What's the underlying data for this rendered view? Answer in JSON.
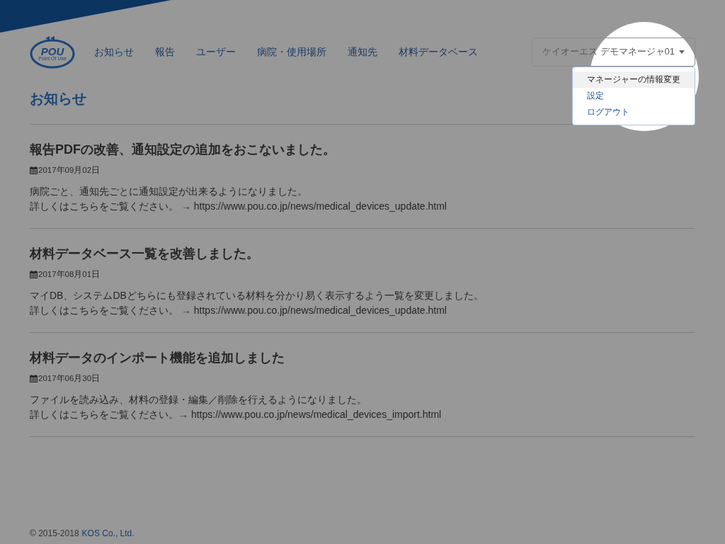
{
  "header": {
    "logo": {
      "text": "POU",
      "subtext": "Point Of Use"
    },
    "nav_items": [
      "お知らせ",
      "報告",
      "ユーザー",
      "病院・使用場所",
      "通知先",
      "材料データベース"
    ],
    "user_menu": {
      "label": "ケイオーエス デモマネージャ01",
      "expanded": true,
      "items": [
        {
          "label": "マネージャーの情報変更",
          "selected": true
        },
        {
          "label": "設定",
          "selected": false
        },
        {
          "label": "ログアウト",
          "selected": false
        }
      ]
    }
  },
  "page_title": "お知らせ",
  "articles": [
    {
      "title": "報告PDFの改善、通知設定の追加をおこないました。",
      "date": "2017年09月02日",
      "lines": [
        "病院ごと、通知先ごとに通知設定が出来るようになりました。",
        "詳しくはこちらをご覧ください。 → https://www.pou.co.jp/news/medical_devices_update.html"
      ]
    },
    {
      "title": "材料データベース一覧を改善しました。",
      "date": "2017年08月01日",
      "lines": [
        "マイDB、システムDBどちらにも登録されている材料を分かり易く表示するよう一覧を変更しました。",
        "詳しくはこちらをご覧ください。 → https://www.pou.co.jp/news/medical_devices_update.html"
      ]
    },
    {
      "title": "材料データのインポート機能を追加しました",
      "date": "2017年06月30日",
      "lines": [
        "ファイルを読み込み、材料の登録・編集／削除を行えるようになりました。",
        "詳しくはこちらをご覧ください。→ https://www.pou.co.jp/news/medical_devices_import.html"
      ]
    }
  ],
  "footer": {
    "copyright": "© 2015-2018",
    "company": "KOS Co., Ltd."
  }
}
